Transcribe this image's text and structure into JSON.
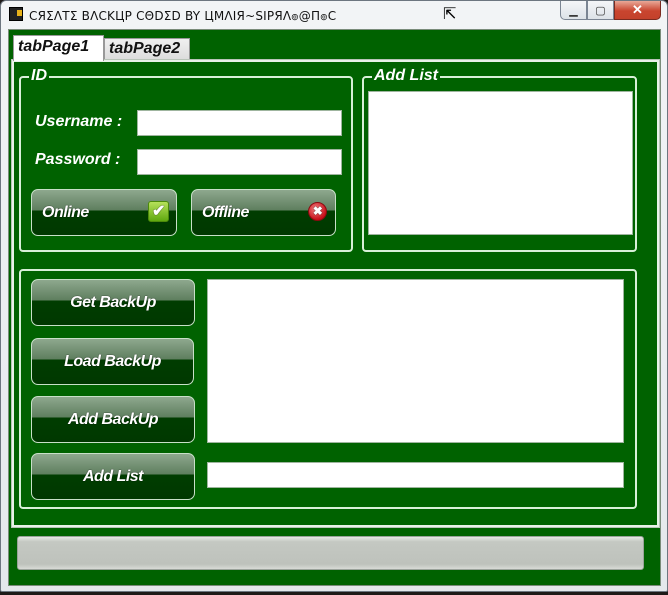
{
  "window": {
    "title": "CЯΣΛTΣ BΛCKЦP CΘDΣD BY ЦMΛIЯ~SIPЯΛ๏@Π๏C",
    "controls": {
      "minimize": "▁",
      "maximize": "▢",
      "close": "✕"
    }
  },
  "tabs": [
    {
      "label": "tabPage1",
      "active": true
    },
    {
      "label": "tabPage2",
      "active": false
    }
  ],
  "id_group": {
    "legend": "ID",
    "username_label": "Username :",
    "username_value": "",
    "password_label": "Password :",
    "password_value": "",
    "online_button": "Online",
    "offline_button": "Offline",
    "online_icon": "check-icon",
    "offline_icon": "x-circle-icon"
  },
  "add_list_group": {
    "legend": "Add List",
    "items": []
  },
  "backup_group": {
    "get_backup_button": "Get BackUp",
    "load_backup_button": "Load BackUp",
    "add_backup_button": "Add BackUp",
    "add_list_button": "Add List",
    "output_text": "",
    "add_list_input": ""
  },
  "progress": {
    "value": 0
  },
  "colors": {
    "background_green": "#006200",
    "button_dark_green": "#003d00",
    "border_light": "#d8f0d8"
  }
}
